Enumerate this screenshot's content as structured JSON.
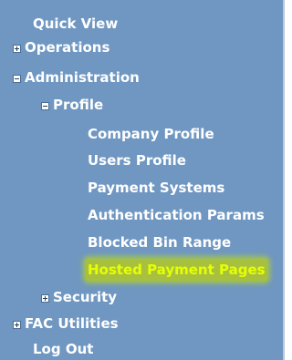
{
  "menu": {
    "quick_view": "Quick View",
    "operations": "Operations",
    "administration": "Administration",
    "profile": "Profile",
    "company_profile": "Company Profile",
    "users_profile": "Users Profile",
    "payment_systems": "Payment Systems",
    "authentication_params": "Authentication Params",
    "blocked_bin_range": "Blocked Bin Range",
    "hosted_payment_pages": "Hosted Payment Pages",
    "security": "Security",
    "fac_utilities": "FAC Utilities",
    "log_out": "Log Out"
  },
  "colors": {
    "panel_bg": "#6f97c2",
    "text": "#ffffff",
    "highlight_bg": "#a7c13e",
    "highlight_text": "#e7ff00"
  }
}
